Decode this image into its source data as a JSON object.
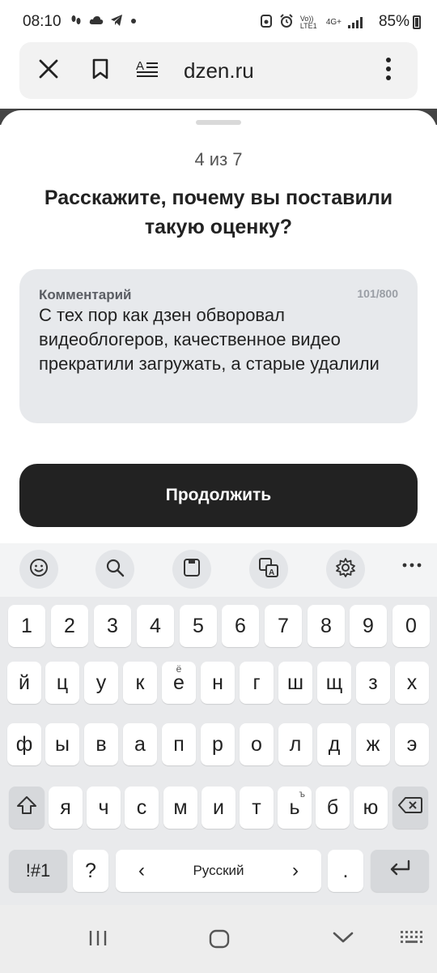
{
  "status_bar": {
    "time": "08:10",
    "left_icons": [
      "footsteps-icon",
      "cloud-icon",
      "telegram-icon",
      "dot-icon"
    ],
    "network_label": "Vo)) LTE1",
    "network_type": "4G+",
    "battery": "85%"
  },
  "browser": {
    "url": "dzen.ru",
    "close_icon": "close-icon",
    "bookmark_icon": "bookmark-icon",
    "reader_icon": "reader-mode-icon",
    "menu_icon": "more-vert-icon"
  },
  "survey": {
    "step": "4 из 7",
    "question": "Расскажите, почему вы поставили такую оценку?",
    "comment_label": "Комментарий",
    "comment_counter": "101/800",
    "comment_text": "С тех пор как дзен обворовал видеоблогеров, качественное видео прекратили загружать, а старые удалили",
    "continue_label": "Продолжить",
    "accent_color": "#222222"
  },
  "keyboard": {
    "toolbar": [
      "emoji-icon",
      "search-icon",
      "clipboard-icon",
      "translate-icon",
      "settings-icon",
      "more-horiz-icon"
    ],
    "row_numbers": [
      "1",
      "2",
      "3",
      "4",
      "5",
      "6",
      "7",
      "8",
      "9",
      "0"
    ],
    "row1": [
      "й",
      "ц",
      "у",
      "к",
      "е",
      "н",
      "г",
      "ш",
      "щ",
      "з",
      "х"
    ],
    "row1_sup": {
      "4": "ё"
    },
    "row2": [
      "ф",
      "ы",
      "в",
      "а",
      "п",
      "р",
      "о",
      "л",
      "д",
      "ж",
      "э"
    ],
    "row3": [
      "я",
      "ч",
      "с",
      "м",
      "и",
      "т",
      "ь",
      "б",
      "ю"
    ],
    "row3_sup": {
      "6": "ъ"
    },
    "symbols_label": "!#1",
    "question_key": "?",
    "space_label": "Русский",
    "space_left": "‹",
    "space_right": "›",
    "period_key": "."
  },
  "navbar": [
    "recents-icon",
    "home-icon",
    "back-icon",
    "keyboard-icon"
  ]
}
